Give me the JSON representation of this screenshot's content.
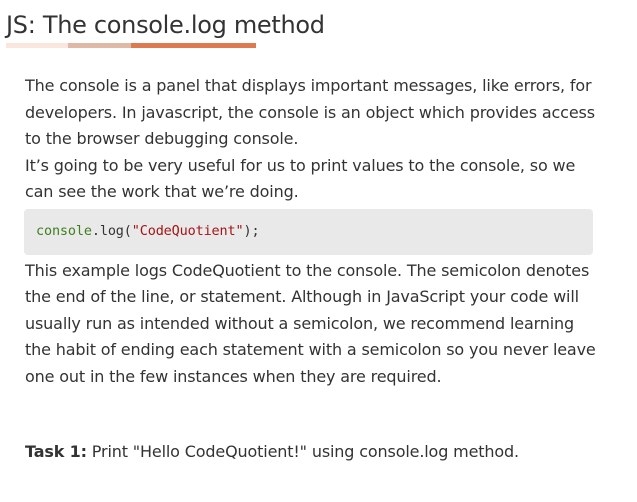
{
  "header": {
    "title": "JS: The console.log method",
    "underline_colors": [
      "#fbe6de",
      "#e0b8a6",
      "#dd7a50"
    ]
  },
  "body": {
    "paragraph_1": "The console is a panel that displays important messages, like errors, for developers. In javascript, the console is an object which provides access to the browser debugging console.",
    "paragraph_2": "It’s going to be very useful for us to print values to the console, so we can see the work that we’re doing.",
    "code": {
      "object": "console",
      "dot": ".",
      "method": "log",
      "open": "(",
      "string": "\"CodeQuotient\"",
      "close": ");",
      "colors": {
        "object": "#3f7f1d",
        "string": "#a31515",
        "plain": "#333333"
      }
    },
    "paragraph_3": "This example logs CodeQuotient to the console. The semicolon denotes the end of the line, or statement. Although in JavaScript your code will usually run as intended without a semicolon, we recommend learning the habit of ending each statement with a semicolon so you never leave one out in the few instances when they are required."
  },
  "task": {
    "label": "Task 1:",
    "text": " Print \"Hello CodeQuotient!\" using console.log method."
  }
}
